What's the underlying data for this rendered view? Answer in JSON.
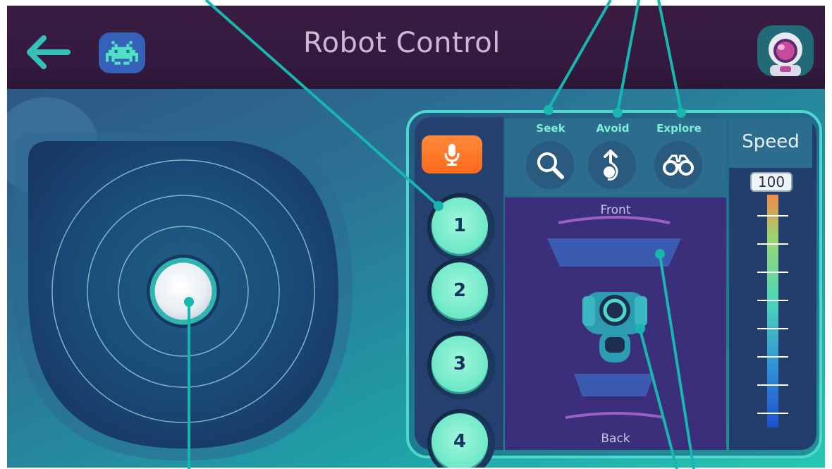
{
  "header": {
    "title": "Robot Control"
  },
  "icons": {
    "back": "back-arrow-icon",
    "game": "space-invader-icon",
    "avatar": "robot-avatar-icon",
    "mic": "microphone-icon"
  },
  "program_buttons": [
    {
      "label": "1"
    },
    {
      "label": "2"
    },
    {
      "label": "3"
    },
    {
      "label": "4"
    }
  ],
  "modes": {
    "seek": {
      "label": "Seek",
      "icon": "magnifier-icon"
    },
    "avoid": {
      "label": "Avoid",
      "icon": "avoid-arrow-icon"
    },
    "explore": {
      "label": "Explore",
      "icon": "binoculars-icon"
    }
  },
  "sensors": {
    "front_label": "Front",
    "back_label": "Back"
  },
  "speed": {
    "title": "Speed",
    "value": "100",
    "level": 1.0
  },
  "colors": {
    "accent": "#4ed8cd",
    "mic_button": "#ff7a2a",
    "topbar": "#361b3f",
    "button_face": "#6ee8c8"
  }
}
